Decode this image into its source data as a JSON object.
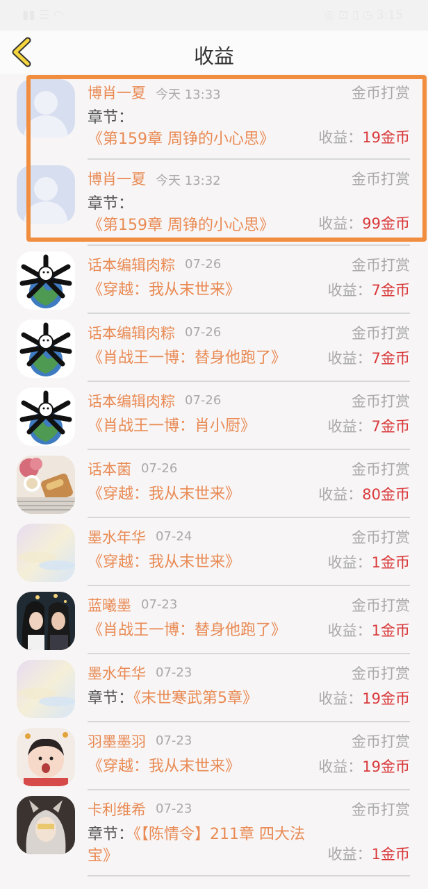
{
  "status": {
    "left": "▮▮ ☰ ◠",
    "right": "◎ ⊡ ▯ ◷ 3:15"
  },
  "header": {
    "title": "收益"
  },
  "entries": [
    {
      "name": "博肖一夏",
      "date": "今天 13:33",
      "type": "金币打赏",
      "prefix": "章节：",
      "text": "《第159章 周铮的小心思》",
      "income_label": "收益：",
      "amount": "19金币",
      "avatar": "placeholder"
    },
    {
      "name": "博肖一夏",
      "date": "今天 13:32",
      "type": "金币打赏",
      "prefix": "章节：",
      "text": "《第159章 周铮的小心思》",
      "income_label": "收益：",
      "amount": "99金币",
      "avatar": "placeholder"
    },
    {
      "name": "话本编辑肉粽",
      "date": "07-26",
      "type": "金币打赏",
      "prefix": "",
      "text": "《穿越：我从末世来》",
      "income_label": "收益：",
      "amount": "7金币",
      "avatar": "earth"
    },
    {
      "name": "话本编辑肉粽",
      "date": "07-26",
      "type": "金币打赏",
      "prefix": "",
      "text": "《肖战王一博：替身他跑了》",
      "income_label": "收益：",
      "amount": "7金币",
      "avatar": "earth"
    },
    {
      "name": "话本编辑肉粽",
      "date": "07-26",
      "type": "金币打赏",
      "prefix": "",
      "text": "《肖战王一博：肖小厨》",
      "income_label": "收益：",
      "amount": "7金币",
      "avatar": "earth"
    },
    {
      "name": "话本菌",
      "date": "07-26",
      "type": "金币打赏",
      "prefix": "",
      "text": "《穿越：我从末世来》",
      "income_label": "收益：",
      "amount": "80金币",
      "avatar": "food"
    },
    {
      "name": "墨水年华",
      "date": "07-24",
      "type": "金币打赏",
      "prefix": "",
      "text": "《穿越：我从末世来》",
      "income_label": "收益：",
      "amount": "1金币",
      "avatar": "pastel"
    },
    {
      "name": "蓝曦墨",
      "date": "07-23",
      "type": "金币打赏",
      "prefix": "",
      "text": "《肖战王一博：替身他跑了》",
      "income_label": "收益：",
      "amount": "1金币",
      "avatar": "people"
    },
    {
      "name": "墨水年华",
      "date": "07-23",
      "type": "金币打赏",
      "prefix": "章节：",
      "text": "《末世寒武第5章》",
      "income_label": "收益：",
      "amount": "19金币",
      "avatar": "pastel"
    },
    {
      "name": "羽墨墨羽",
      "date": "07-23",
      "type": "金币打赏",
      "prefix": "",
      "text": "《穿越：我从末世来》",
      "income_label": "收益：",
      "amount": "19金币",
      "avatar": "baby"
    },
    {
      "name": "卡利维希",
      "date": "07-23",
      "type": "金币打赏",
      "prefix": "章节：",
      "text": "《【陈情令】211章 四大法宝》",
      "income_label": "收益：",
      "amount": "1金币",
      "avatar": "anime"
    }
  ]
}
